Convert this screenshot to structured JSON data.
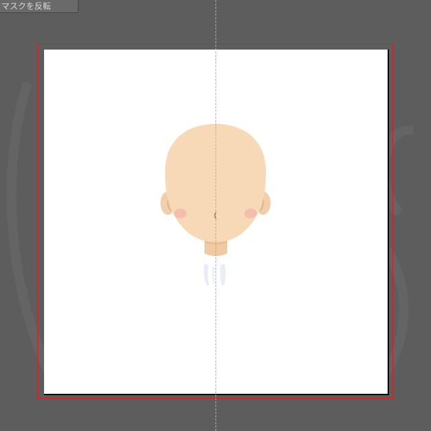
{
  "toolbar": {
    "mask_invert_label": "マスクを反転"
  },
  "colors": {
    "workspace_bg": "#5d5d5d",
    "canvas_bg": "#ffffff",
    "bleed_frame": "#d02020",
    "guide": "#66c9d6",
    "skin": "#f7d9b7",
    "skin_shadow": "#ecc49b",
    "blush": "#f4a5a8"
  },
  "canvas": {
    "guide": "vertical-center",
    "layer_content": [
      "head",
      "left-ear",
      "right-ear",
      "left-cheek-blush",
      "right-cheek-blush",
      "nose",
      "neck",
      "collar"
    ]
  }
}
